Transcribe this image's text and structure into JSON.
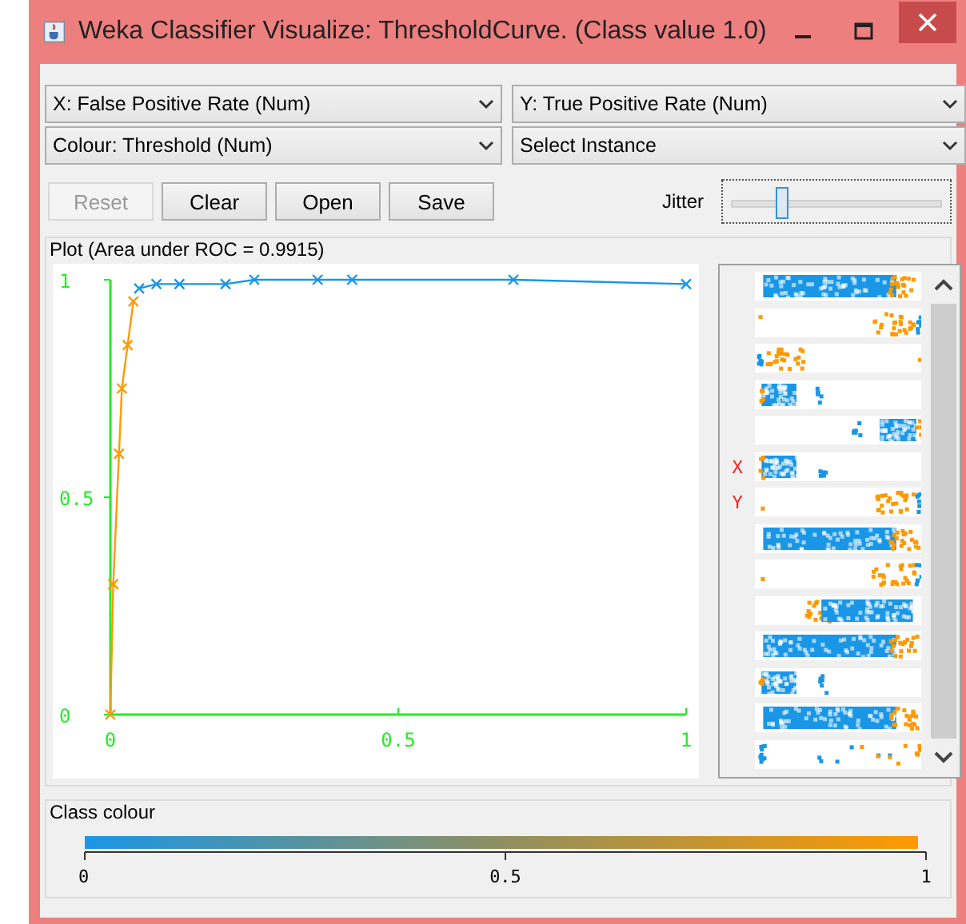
{
  "window": {
    "title": "Weka Classifier Visualize: ThresholdCurve. (Class value 1.0)"
  },
  "selectors": [
    {
      "value": "X: False Positive Rate (Num)"
    },
    {
      "value": "Y: True Positive Rate (Num)"
    },
    {
      "value": "Colour: Threshold (Num)"
    },
    {
      "value": "Select Instance"
    }
  ],
  "buttons": [
    {
      "label": "Reset",
      "disabled": true
    },
    {
      "label": "Clear",
      "disabled": false
    },
    {
      "label": "Open",
      "disabled": false
    },
    {
      "label": "Save",
      "disabled": false
    }
  ],
  "jitter": {
    "label": "Jitter",
    "level": 0.24
  },
  "plot": {
    "title": "Plot (Area under ROC = 0.9915)",
    "chart_data": {
      "type": "line",
      "x": [
        0,
        0.005,
        0.015,
        0.02,
        0.03,
        0.04,
        0.05,
        0.08,
        0.12,
        0.2,
        0.25,
        0.36,
        0.42,
        0.7,
        1
      ],
      "series": [
        {
          "color": "#ff9900",
          "marker": "x",
          "values": [
            0,
            0.3,
            0.6,
            0.75,
            0.85,
            0.95,
            null,
            null,
            null,
            null,
            null,
            null,
            null,
            null,
            null
          ]
        },
        {
          "color": "#1a96e6",
          "marker": "x",
          "values": [
            null,
            null,
            null,
            null,
            null,
            null,
            0.98,
            0.99,
            0.99,
            0.99,
            1,
            1,
            1,
            1,
            0.99
          ]
        }
      ],
      "xlim": [
        0,
        1
      ],
      "ylim": [
        0,
        1
      ],
      "xticks": [
        {
          "value": 0,
          "label": "0"
        },
        {
          "value": 0.5,
          "label": "0.5"
        },
        {
          "value": 1,
          "label": "1"
        }
      ],
      "yticks": [
        {
          "value": 0,
          "label": "0"
        },
        {
          "value": 0.5,
          "label": "0.5"
        },
        {
          "value": 1,
          "label": "1"
        }
      ]
    }
  },
  "attribute_strips": [
    {
      "kind": "blue-orange"
    },
    {
      "kind": "orange-right"
    },
    {
      "kind": "orange-left"
    },
    {
      "kind": "blue-left"
    },
    {
      "kind": "blue-right"
    },
    {
      "kind": "blue-left",
      "marker": "X"
    },
    {
      "kind": "orange-right",
      "marker": "Y"
    },
    {
      "kind": "blue-orange"
    },
    {
      "kind": "orange-right"
    },
    {
      "kind": "orange-blue"
    },
    {
      "kind": "blue-orange"
    },
    {
      "kind": "blue-left"
    },
    {
      "kind": "blue-orange"
    },
    {
      "kind": "sparse"
    }
  ],
  "class_colour": {
    "title": "Class colour",
    "ticks": [
      "0",
      "0.5",
      "1"
    ]
  }
}
